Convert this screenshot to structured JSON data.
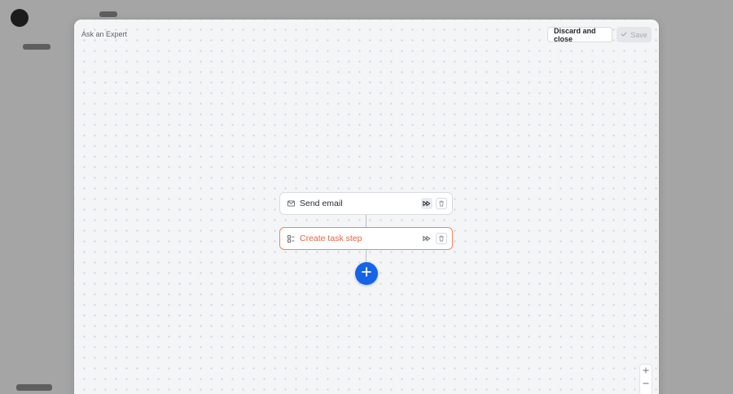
{
  "modal": {
    "title": "Ask an Expert",
    "discard_label": "Discard and close",
    "save_label": "Save"
  },
  "flow": {
    "steps": [
      {
        "label": "Send email",
        "icon": "mail-icon",
        "state": "default"
      },
      {
        "label": "Create task step",
        "icon": "task-icon",
        "state": "selected"
      }
    ],
    "add_step_icon": "plus-icon"
  },
  "zoom": {
    "in_icon": "plus-icon",
    "out_icon": "minus-icon"
  },
  "colors": {
    "accent": "#1664e5",
    "selected_step": "#e8643d",
    "canvas": "#f4f5f7"
  }
}
